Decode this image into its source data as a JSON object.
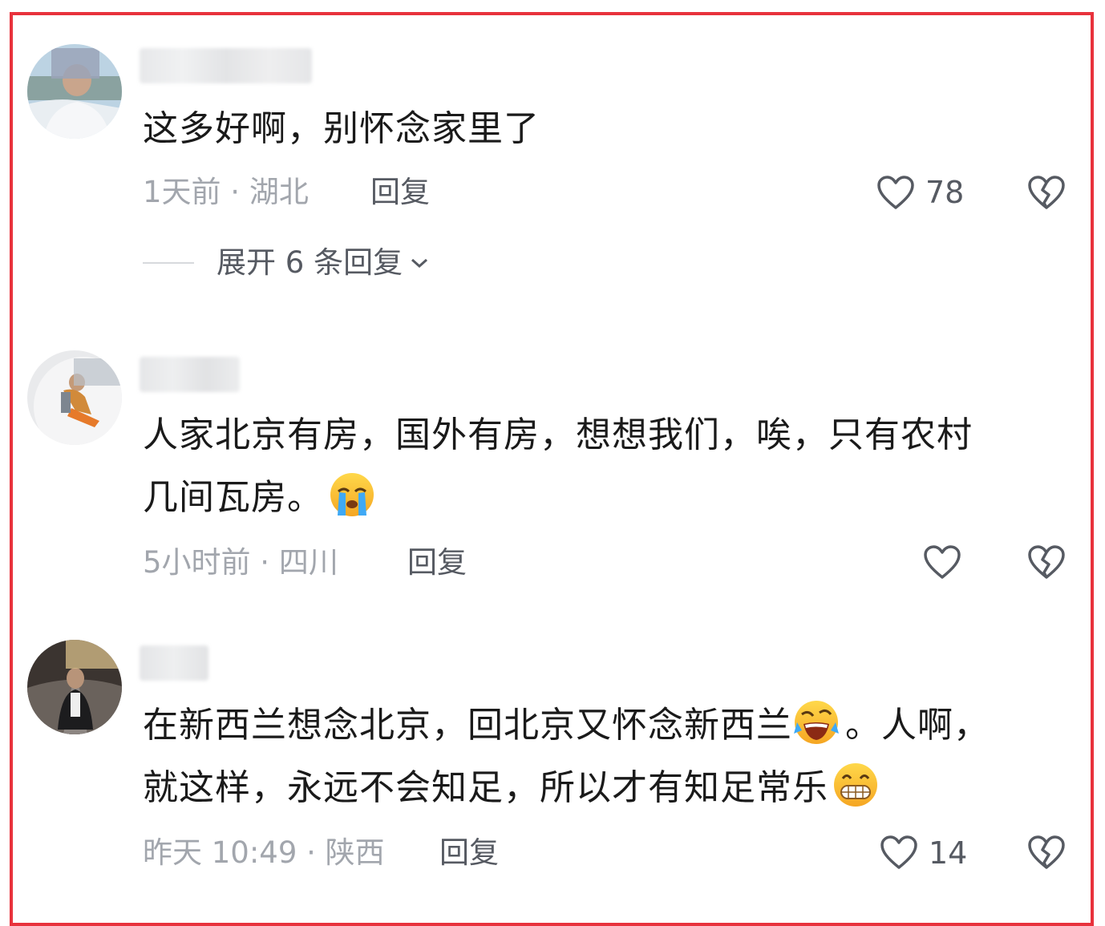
{
  "comments": [
    {
      "text": "这多好啊，别怀念家里了",
      "meta": "1天前 · 湖北",
      "reply_label": "回复",
      "likes": "78",
      "replies_label": "展开 6 条回复"
    },
    {
      "text_line1": "人家北京有房，国外有房，想想我们，唉，只有农村",
      "text_line2": "几间瓦房。",
      "meta": "5小时前 · 四川",
      "reply_label": "回复"
    },
    {
      "text_line1a": "在新西兰想念北京，回北京又怀念新西兰",
      "text_line1b": "。人啊，",
      "text_line2": "就这样，永远不会知足，所以才有知足常乐",
      "meta": "昨天 10:49 · 陕西",
      "reply_label": "回复",
      "likes": "14"
    }
  ],
  "icons": {
    "like": "heart-outline-icon",
    "dislike": "broken-heart-icon",
    "expand": "chevron-down-icon",
    "emoji_cry": "loudly-crying-face",
    "emoji_laugh_cry": "rolling-on-floor-laughing",
    "emoji_grin": "grinning-face"
  },
  "colors": {
    "frame_border": "#e8323c",
    "text": "#1a1a1a",
    "meta": "#a2a6ad",
    "action": "#565a62"
  }
}
